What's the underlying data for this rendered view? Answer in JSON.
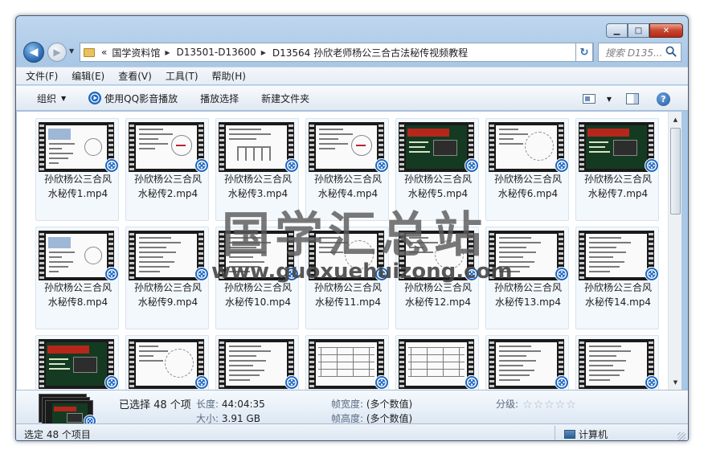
{
  "window": {
    "minimize_glyph": "▁",
    "maximize_glyph": "□",
    "close_glyph": "✕"
  },
  "navigation": {
    "back_glyph": "◀",
    "forward_glyph": "▶",
    "history_glyph": "▼",
    "overflow_glyph": "«",
    "breadcrumb": [
      "国学资料馆",
      "D13501-D13600",
      "D13564 孙欣老师杨公三合古法秘传视频教程"
    ],
    "separator_glyph": "▶",
    "address_dropdown_glyph": "▼",
    "refresh_glyph": "↻",
    "search_placeholder": "搜索 D135..."
  },
  "menubar": {
    "items": [
      "文件(F)",
      "编辑(E)",
      "查看(V)",
      "工具(T)",
      "帮助(H)"
    ]
  },
  "toolbar": {
    "organize": "组织",
    "organize_arrow": "▼",
    "play_qq": "使用QQ影音播放",
    "play_selection": "播放选择",
    "new_folder": "新建文件夹",
    "view_arrow": "▼",
    "help_glyph": "?"
  },
  "files": [
    {
      "line1": "孙欣杨公三合风",
      "line2": "水秘传1.mp4",
      "thumb": "doc"
    },
    {
      "line1": "孙欣杨公三合风",
      "line2": "水秘传2.mp4",
      "thumb": "diagram"
    },
    {
      "line1": "孙欣杨公三合风",
      "line2": "水秘传3.mp4",
      "thumb": "tree"
    },
    {
      "line1": "孙欣杨公三合风",
      "line2": "水秘传4.mp4",
      "thumb": "diagram"
    },
    {
      "line1": "孙欣杨公三合风",
      "line2": "水秘传5.mp4",
      "thumb": "green"
    },
    {
      "line1": "孙欣杨公三合风",
      "line2": "水秘传6.mp4",
      "thumb": "compass"
    },
    {
      "line1": "孙欣杨公三合风",
      "line2": "水秘传7.mp4",
      "thumb": "green"
    },
    {
      "line1": "孙欣杨公三合风",
      "line2": "水秘传8.mp4",
      "thumb": "doc"
    },
    {
      "line1": "孙欣杨公三合风",
      "line2": "水秘传9.mp4",
      "thumb": "text"
    },
    {
      "line1": "孙欣杨公三合风",
      "line2": "水秘传10.mp4",
      "thumb": "text"
    },
    {
      "line1": "孙欣杨公三合风",
      "line2": "水秘传11.mp4",
      "thumb": "compass"
    },
    {
      "line1": "孙欣杨公三合风",
      "line2": "水秘传12.mp4",
      "thumb": "compass"
    },
    {
      "line1": "孙欣杨公三合风",
      "line2": "水秘传13.mp4",
      "thumb": "text"
    },
    {
      "line1": "孙欣杨公三合风",
      "line2": "水秘传14.mp4",
      "thumb": "text"
    },
    {
      "line1": "",
      "line2": "",
      "thumb": "green"
    },
    {
      "line1": "",
      "line2": "",
      "thumb": "compass"
    },
    {
      "line1": "",
      "line2": "",
      "thumb": "text"
    },
    {
      "line1": "",
      "line2": "",
      "thumb": "table"
    },
    {
      "line1": "",
      "line2": "",
      "thumb": "table"
    },
    {
      "line1": "",
      "line2": "",
      "thumb": "text"
    },
    {
      "line1": "",
      "line2": "",
      "thumb": "text"
    }
  ],
  "watermark": {
    "chinese": "国学汇总站",
    "url": "www.guoxuehuizong.com"
  },
  "details": {
    "selected": "已选择 48 个项",
    "length_key": "长度:",
    "length_val": "44:04:35",
    "size_key": "大小:",
    "size_val": "3.91 GB",
    "width_key": "帧宽度:",
    "width_val": "(多个数值)",
    "height_key": "帧高度:",
    "height_val": "(多个数值)",
    "rating_key": "分级:",
    "rating_max": 5,
    "star_glyph": "☆"
  },
  "statusbar": {
    "left": "选定 48 个项目",
    "right": "计算机"
  },
  "colors": {
    "accent": "#1f67c1",
    "tile_bg": "#f3f8fd",
    "chrome": "#a9c7e6"
  }
}
